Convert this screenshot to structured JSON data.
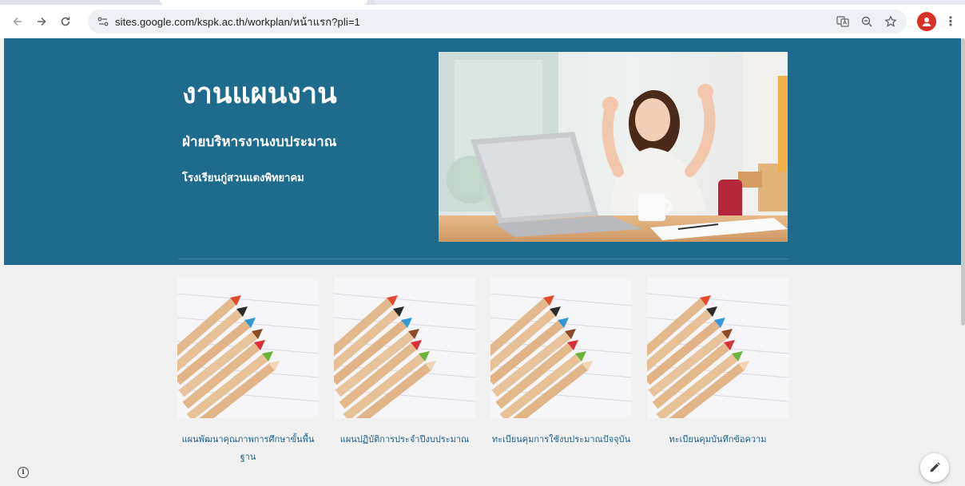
{
  "browser": {
    "url": "sites.google.com/kspk.ac.th/workplan/หน้าแรก?pli=1",
    "icons": [
      "back-arrow-icon",
      "forward-arrow-icon",
      "reload-icon",
      "site-info-icon",
      "translate-icon",
      "zoom-icon",
      "star-icon",
      "profile-icon",
      "menu-dots-icon"
    ]
  },
  "hero": {
    "title": "งานแผนงาน",
    "subtitle": "ฝ่ายบริหารงานงบประมาณ",
    "school": "โรงเรียนกู่สวนแตงพิทยาคม"
  },
  "cards": [
    {
      "label": "แผนพัฒนาคุณภาพการศึกษาขั้นพื้นฐาน"
    },
    {
      "label": "แผนปฏิบัติการประจำปีงบประมาณ"
    },
    {
      "label": "ทะเบียนคุมการใช้งบประมาณปัจจุบัน"
    },
    {
      "label": "ทะเบียนคุมบันทึกข้อความ"
    }
  ],
  "colors": {
    "hero_bg": "#1f6b8e",
    "card_label": "#1f5f86",
    "page_bg": "#f1f1f1"
  }
}
